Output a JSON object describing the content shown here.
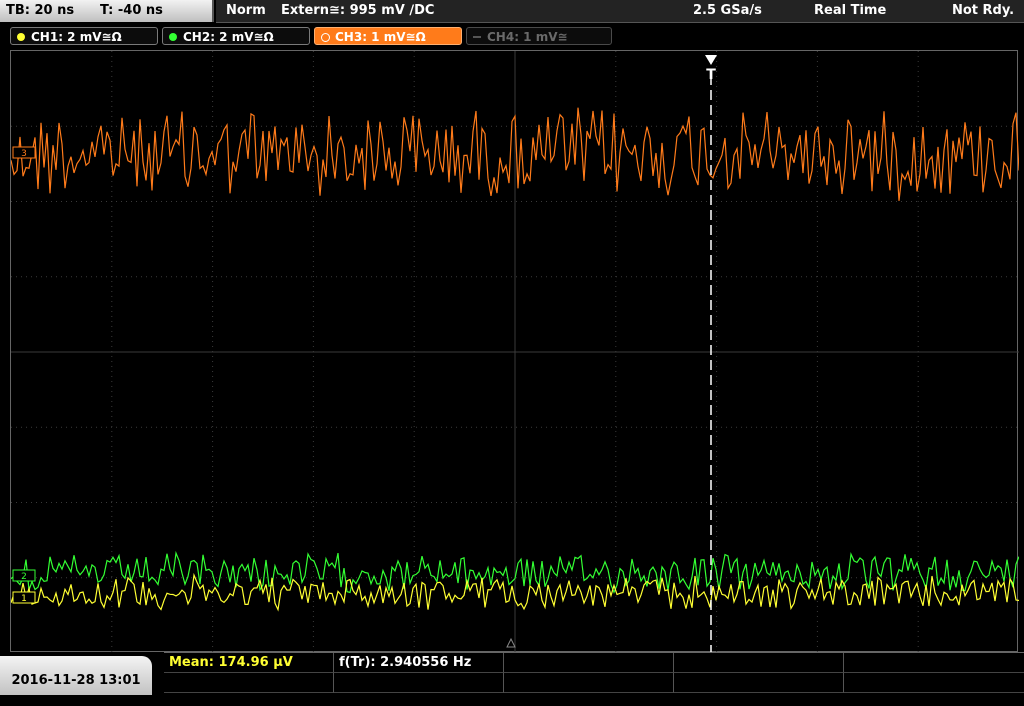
{
  "timebase": {
    "tb": "TB: 20 ns",
    "trigger_offset": "T: -40 ns"
  },
  "status": {
    "mode": "Norm",
    "trigger": "Extern≅: 995 mV ∕DC",
    "rate": "2.5 GSa/s",
    "acq": "Real Time",
    "state": "Not Rdy."
  },
  "channels": [
    {
      "label": "CH1: 2 mV≅Ω",
      "color": "#ffff33"
    },
    {
      "label": "CH2: 2 mV≅Ω",
      "color": "#33ff33"
    },
    {
      "label": "CH3: 1 mV≅Ω",
      "color": "#ff7b1a"
    },
    {
      "label": "CH4: 1 mV≅",
      "color": "#6a6a6a"
    }
  ],
  "markers": {
    "trigger": "T",
    "ch3": "3",
    "ch2": "2",
    "ch1": "1"
  },
  "datetime": "2016-11-28 13:01",
  "measurements": {
    "mean": "Mean: 174.96 µV",
    "freq": "f(Tr): 2.940556 Hz"
  },
  "colors": {
    "ch1": "#ffff33",
    "ch2": "#33ff33",
    "ch3": "#ff7b1a",
    "grid": "#3a3a3a",
    "trigger_line": "#ffffff"
  }
}
